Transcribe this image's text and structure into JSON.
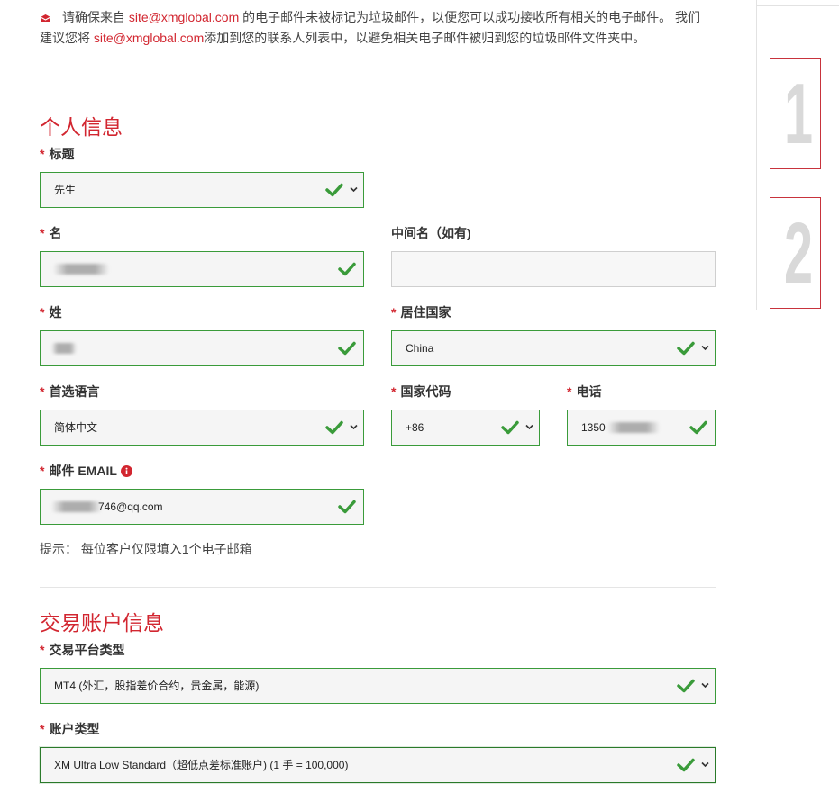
{
  "notice": {
    "text_before": "请确保来自",
    "email1": "site@xmglobal.com",
    "text_middle": "的电子邮件未被标记为垃圾邮件，以便您可以成功接收所有相关的电子邮件。 我们建议您将",
    "email2": "site@xmglobal.com",
    "text_after": "添加到您的联系人列表中，以避免相关电子邮件被归到您的垃圾邮件文件夹中。"
  },
  "personal": {
    "title": "个人信息",
    "salutation": {
      "label": "标题",
      "value": "先生"
    },
    "first_name": {
      "label": "名",
      "value": ""
    },
    "middle_name": {
      "label": "中间名（如有)"
    },
    "last_name": {
      "label": "姓",
      "value": ""
    },
    "country": {
      "label": "居住国家",
      "value": "China"
    },
    "language": {
      "label": "首选语言",
      "value": "简体中文"
    },
    "country_code": {
      "label": "国家代码",
      "value": "+86"
    },
    "phone": {
      "label": "电话",
      "value": "1350"
    },
    "email": {
      "label": "邮件 EMAIL",
      "value": "746@qq.com"
    },
    "hint": "提示：   每位客户仅限填入1个电子邮箱"
  },
  "trading": {
    "title": "交易账户信息",
    "platform": {
      "label": "交易平台类型",
      "value": "MT4 (外汇，股指差价合约，贵金属，能源)"
    },
    "account_type": {
      "label": "账户类型",
      "value": "XM Ultra Low Standard（超低点差标准账户)   (1 手 = 100,000)"
    }
  },
  "steps": [
    "1",
    "2"
  ],
  "colors": {
    "accent": "#d22630",
    "valid": "#3a9b3a"
  },
  "icons": {
    "notice": "envelope-icon",
    "valid": "check-icon",
    "dropdown": "chevron-down-icon",
    "info": "info-icon"
  }
}
